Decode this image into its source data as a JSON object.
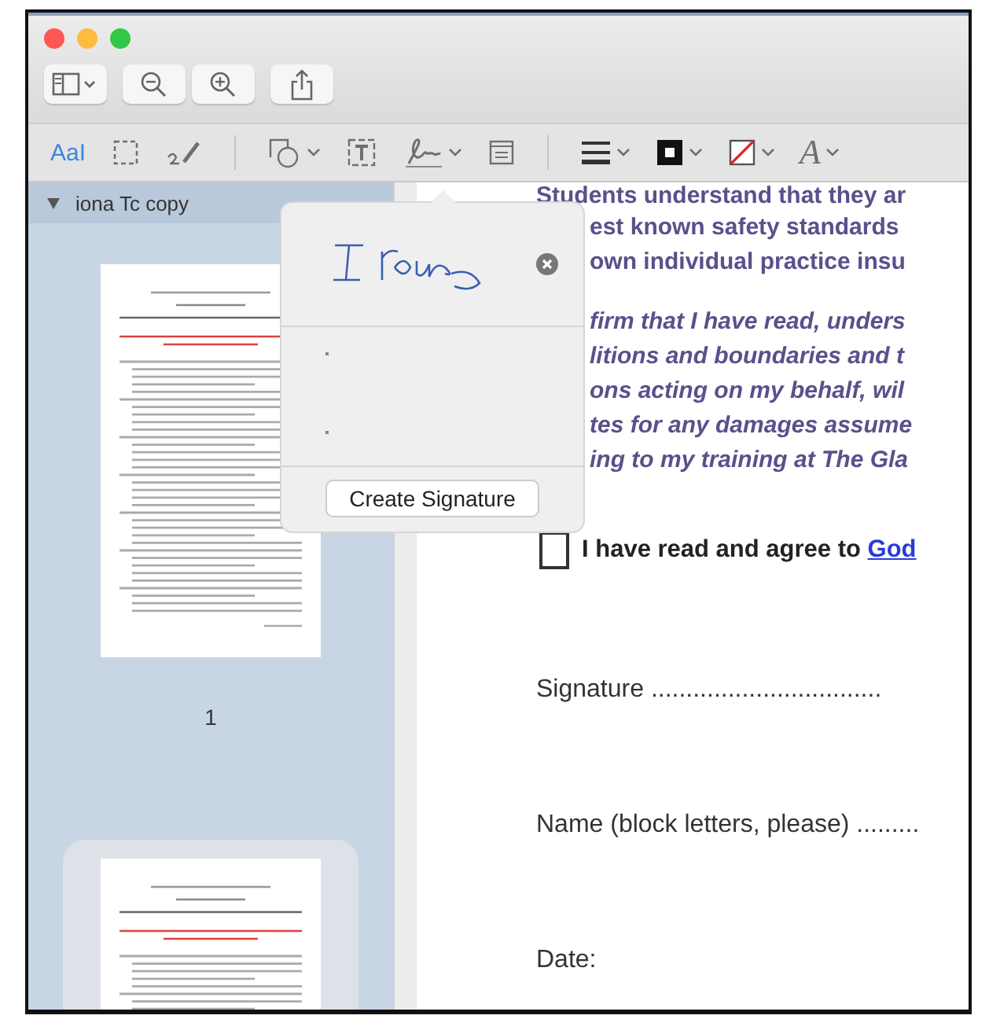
{
  "window": {
    "controls": [
      {
        "kind": "close"
      },
      {
        "kind": "minimize"
      },
      {
        "kind": "zoom"
      }
    ]
  },
  "toolbar": {
    "buttons": [
      {
        "kind": "sidebar"
      },
      {
        "kind": "zoom-out"
      },
      {
        "kind": "zoom-in"
      },
      {
        "kind": "share"
      }
    ]
  },
  "markup_toolbar": {
    "tools": [
      {
        "kind": "text",
        "label": "AaI",
        "selected": true
      },
      {
        "kind": "select",
        "selected": false
      },
      {
        "kind": "sketch",
        "selected": false
      },
      {
        "kind": "shapes",
        "selected": false
      },
      {
        "kind": "textbox",
        "selected": false
      },
      {
        "kind": "sign",
        "selected": false
      },
      {
        "kind": "note",
        "selected": false
      },
      {
        "kind": "lines",
        "selected": false
      },
      {
        "kind": "border",
        "selected": false
      },
      {
        "kind": "fill",
        "selected": false
      },
      {
        "kind": "font",
        "label": "A",
        "selected": false
      }
    ]
  },
  "sidebar": {
    "document": "iona Tc copy",
    "expanded": true,
    "pages": [
      {
        "label": "1",
        "selected": false
      },
      {
        "selected": true
      }
    ]
  },
  "signature_popover": {
    "signatures": [
      {
        "kind": "handwritten"
      }
    ],
    "create_button": "Create Signature"
  },
  "document": {
    "paragraphs": [
      {
        "kind": "bold",
        "lines": [
          "Students understand that they ar",
          "est known safety standards",
          "own individual practice insu"
        ]
      },
      {
        "kind": "bold-italic",
        "lines": [
          "firm that I have read, unders",
          "litions and boundaries and t",
          "ons acting on my behalf, wil",
          "tes for any damages assume",
          "ing to my training at The Gla"
        ]
      }
    ],
    "agreement": {
      "checked": false,
      "text": "I have read and agree to ",
      "link": "God"
    },
    "fields": [
      "Signature .................................",
      "Name (block letters, please) .........",
      "Date:"
    ]
  }
}
